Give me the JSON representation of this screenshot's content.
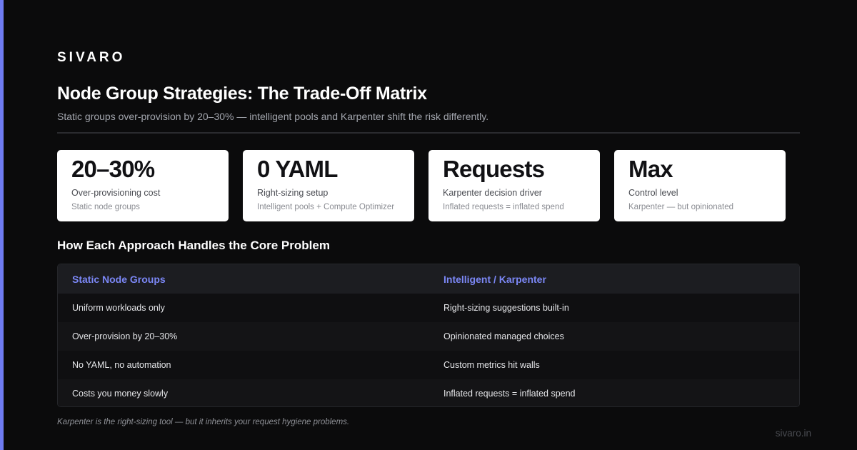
{
  "brand": "SIVARO",
  "title": "Node Group Strategies: The Trade-Off Matrix",
  "subtitle": "Static groups over-provision by 20–30% — intelligent pools and Karpenter shift the risk differently.",
  "colors": {
    "accent": "#6f7cf2",
    "background": "#0b0b0c",
    "card": "#ffffff",
    "column_heading": "#7b87f5"
  },
  "cards": [
    {
      "value": "20–30%",
      "label": "Over-provisioning cost",
      "note": "Static node groups"
    },
    {
      "value": "0 YAML",
      "label": "Right-sizing setup",
      "note": "Intelligent pools + Compute Optimizer"
    },
    {
      "value": "Requests",
      "label": "Karpenter decision driver",
      "note": "Inflated requests = inflated spend"
    },
    {
      "value": "Max",
      "label": "Control level",
      "note": "Karpenter — but opinionated"
    }
  ],
  "section_title": "How Each Approach Handles the Core Problem",
  "matrix": {
    "headers": [
      "Static Node Groups",
      "Intelligent / Karpenter"
    ],
    "rows": [
      [
        "Uniform workloads only",
        "Right-sizing suggestions built-in"
      ],
      [
        "Over-provision by 20–30%",
        "Opinionated managed choices"
      ],
      [
        "No YAML, no automation",
        "Custom metrics hit walls"
      ],
      [
        "Costs you money slowly",
        "Inflated requests = inflated spend"
      ]
    ]
  },
  "footnote": "Karpenter is the right-sizing tool — but it inherits your request hygiene problems.",
  "site": "sivaro.in"
}
